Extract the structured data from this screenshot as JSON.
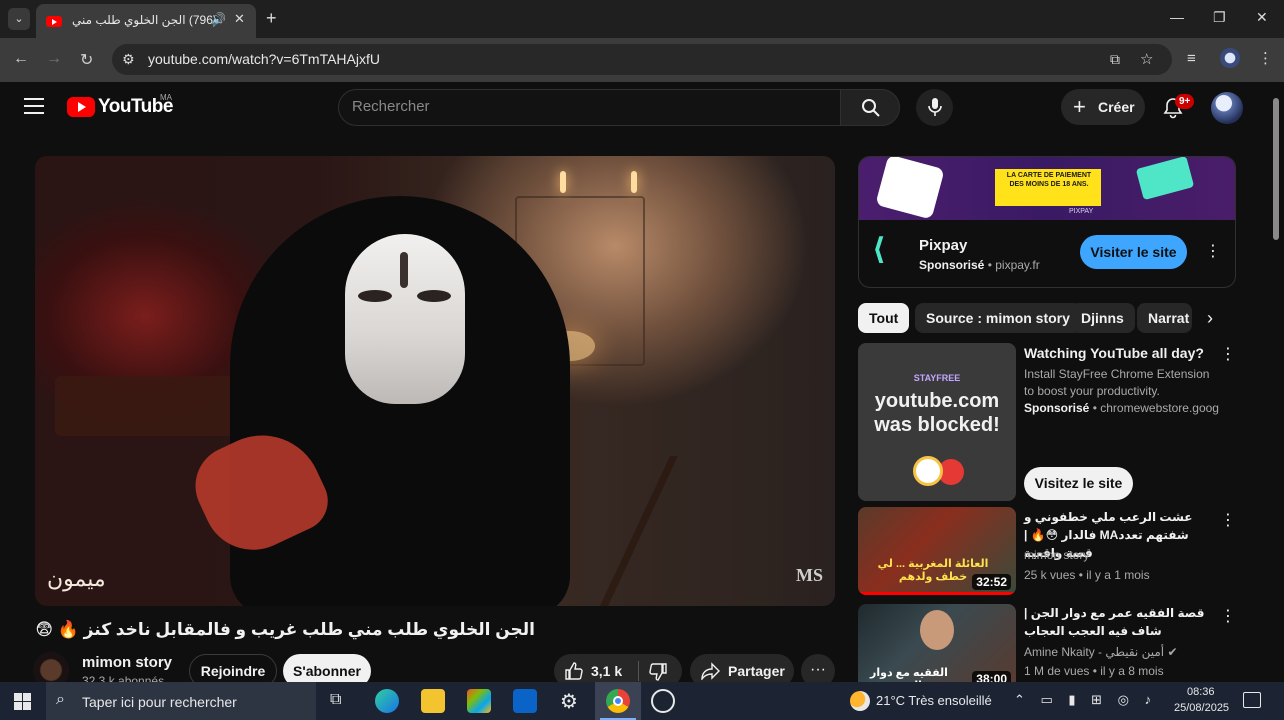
{
  "browser": {
    "tab_title": "(796) الجن الخلوي طلب مني",
    "url": "youtube.com/watch?v=6TmTAHAjxfU",
    "window_controls": [
      "minimize",
      "maximize",
      "close"
    ]
  },
  "header": {
    "logo_text": "YouTube",
    "country_code": "MA",
    "search_placeholder": "Rechercher",
    "create_label": "Créer",
    "notification_count": "9+"
  },
  "video": {
    "title": "الجن الخلوي طلب مني طلب غريب و فالمقابل ناخد كنز 🔥 😨",
    "watermark": "ميمون",
    "corner_mark": "MS",
    "channel_name": "mimon story",
    "channel_subs": "32,3 k abonnés",
    "join_label": "Rejoindre",
    "subscribe_label": "S'abonner",
    "like_count": "3,1 k",
    "share_label": "Partager",
    "more_label": "···"
  },
  "ad": {
    "banner_text": "LA CARTE DE PAIEMENT DES MOINS DE 18 ANS.",
    "brand": "PIXPAY",
    "name": "Pixpay",
    "sponsored_label": "Sponsorisé",
    "domain": "pixpay.fr",
    "visit_label": "Visiter le site"
  },
  "chips": [
    "Tout",
    "Source : mimon story",
    "Djinns",
    "Narrat"
  ],
  "sidebar_ad": {
    "brand": "STAYFREE",
    "thumb_text": "youtube.com was blocked!",
    "title": "Watching YouTube all day?",
    "description": "Install StayFree Chrome Extension to boost your productivity.",
    "sponsored_label": "Sponsorisé",
    "domain": "chromewebstore.goog...",
    "visit_label": "Visitez le site"
  },
  "sidebar_items": [
    {
      "title": "عشت الرعب ملي خطفوني و شفتهم تعددMA فالدار 😳🔥 | قصة واقعية",
      "channel": "mimon story",
      "meta": "25 k vues • il y a 1 mois",
      "duration": "32:52",
      "thumb_text": "العائلة المغربية ... لي خطف ولدهم",
      "progress": 1.0
    },
    {
      "title": "قصة الفقيه عمر مع دوار الجن | شاف فيه العجب العجاب",
      "channel": "Amine Nkaity - أمين نقيطي",
      "meta": "1 M de vues • il y a 8 mois",
      "duration": "38:00",
      "thumb_text": "الفقيه مع دوار الجن",
      "progress": 0.0
    }
  ],
  "taskbar": {
    "search_placeholder": "Taper ici pour rechercher",
    "weather": "21°C  Très ensoleillé",
    "time": "08:36",
    "date": "25/08/2025"
  }
}
